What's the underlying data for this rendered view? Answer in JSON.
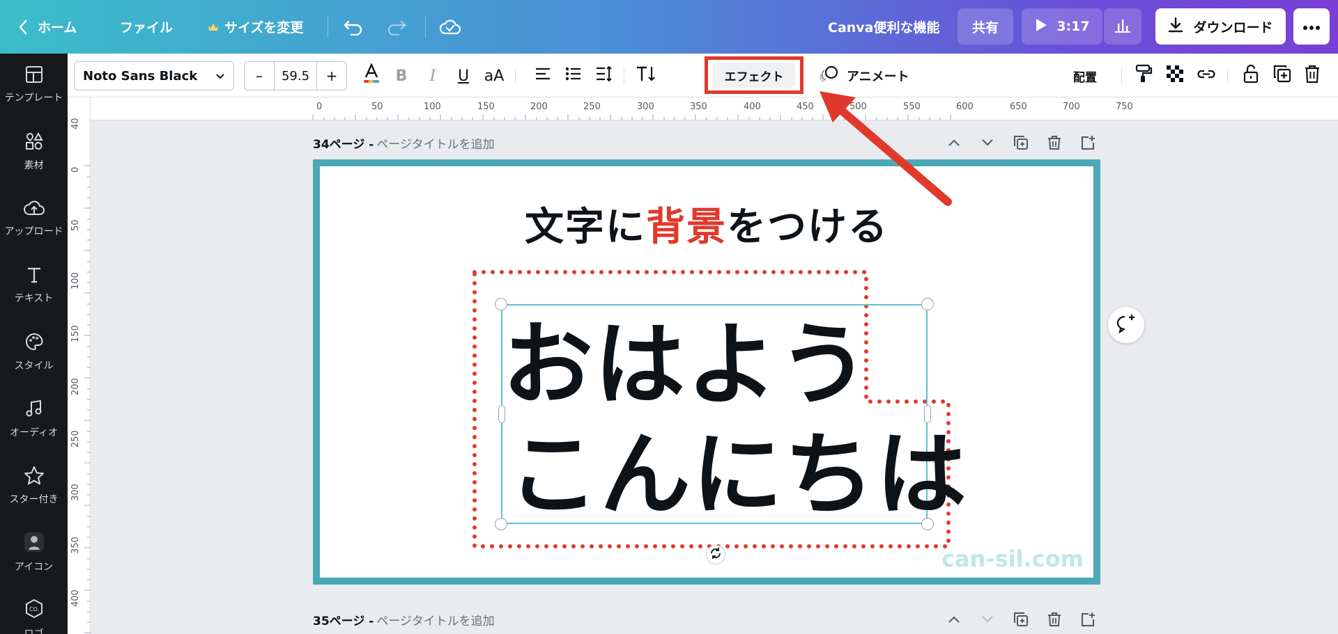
{
  "header": {
    "home_label": "ホーム",
    "file_label": "ファイル",
    "resize_label": "サイズを変更",
    "project_title": "Canva便利な機能",
    "share_label": "共有",
    "play_time": "3:17",
    "download_label": "ダウンロード"
  },
  "sidebar": {
    "items": [
      {
        "label": "テンプレート",
        "icon": "template-icon"
      },
      {
        "label": "素材",
        "icon": "elements-icon"
      },
      {
        "label": "アップロード",
        "icon": "upload-icon"
      },
      {
        "label": "テキスト",
        "icon": "text-icon"
      },
      {
        "label": "スタイル",
        "icon": "palette-icon"
      },
      {
        "label": "オーディオ",
        "icon": "music-icon"
      },
      {
        "label": "スター付き",
        "icon": "star-icon"
      },
      {
        "label": "アイコン",
        "icon": "avatar-icon"
      },
      {
        "label": "ロゴ",
        "icon": "logo-icon"
      }
    ]
  },
  "toolbar": {
    "font_name": "Noto Sans Black",
    "font_size": "59.5",
    "minus": "–",
    "plus": "+",
    "effect_label": "エフェクト",
    "animate_label": "アニメート",
    "arrange_label": "配置",
    "bold": "B",
    "italic": "I",
    "underline": "U",
    "case": "aA"
  },
  "ruler": {
    "top_ticks": [
      "0",
      "50",
      "100",
      "150",
      "200",
      "250",
      "300",
      "350",
      "400",
      "450",
      "500",
      "550",
      "600",
      "650",
      "700",
      "750"
    ],
    "left_ticks": [
      "40",
      "0",
      "50",
      "100",
      "150",
      "200",
      "250",
      "300",
      "350",
      "400"
    ]
  },
  "page34": {
    "number": "34ページ -",
    "title_placeholder": "ページタイトルを追加",
    "heading_pre": "文字に",
    "heading_red": "背景",
    "heading_post": "をつける",
    "line1": "おはよう",
    "line2": "こんにちは",
    "watermark": "can-sil.com"
  },
  "page35": {
    "number": "35ページ -",
    "title_placeholder": "ページタイトルを追加"
  },
  "colors": {
    "accent_red": "#e0392b",
    "page_border": "#4aa9b5",
    "selection": "#58c4cf"
  }
}
